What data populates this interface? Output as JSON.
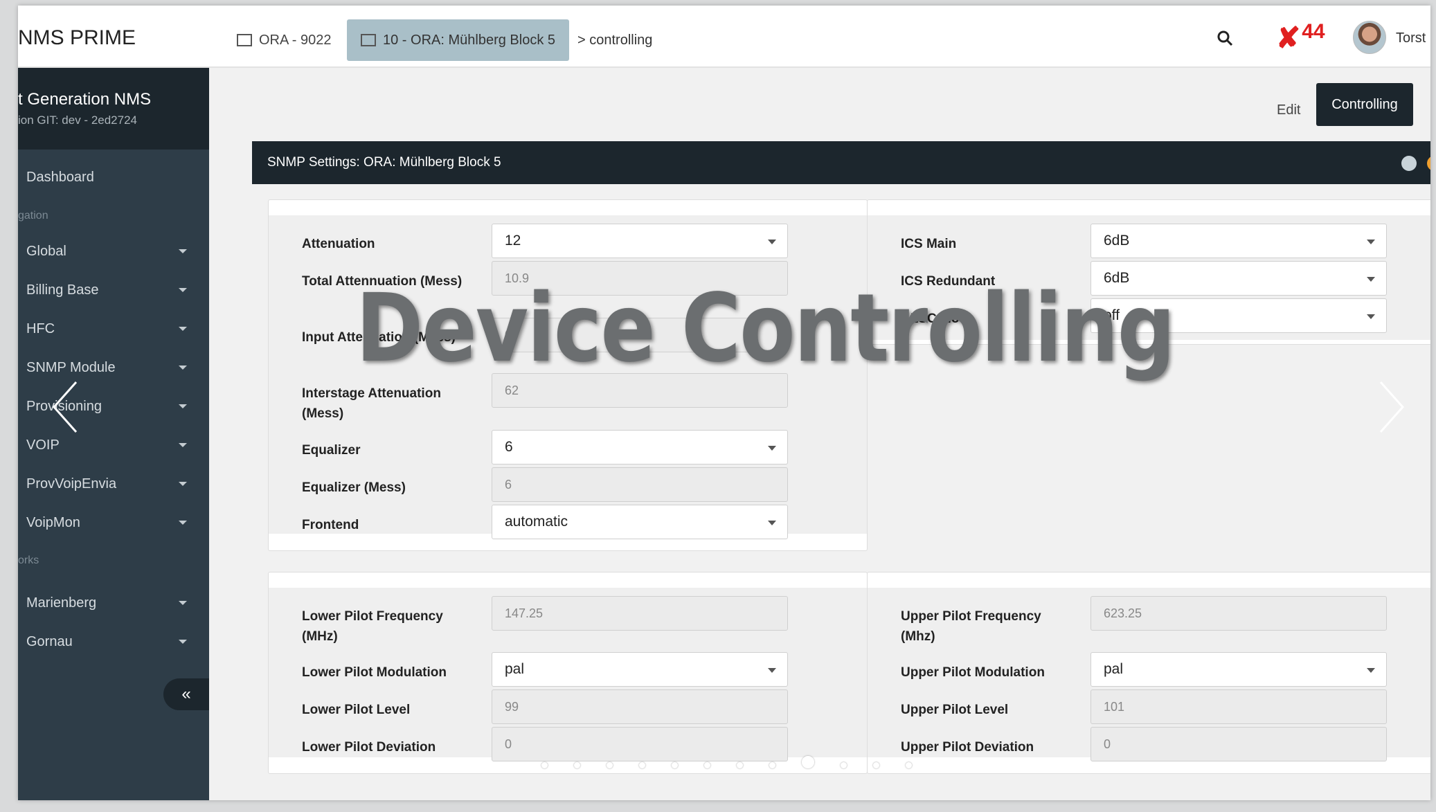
{
  "header": {
    "brand": "NMS PRIME",
    "breadcrumbs": [
      "ORA - 9022",
      "10 - ORA: Mühlberg Block 5"
    ],
    "breadcrumb_last": "> controlling",
    "alarm_count": "44",
    "username": "Torst"
  },
  "sidebar": {
    "title": "t Generation NMS",
    "subtitle": "ion GIT: dev - 2ed2724",
    "dashboard": "Dashboard",
    "section_1": "gation",
    "items": [
      "Global",
      "Billing Base",
      "HFC",
      "SNMP Module",
      "Provisioning",
      "VOIP",
      "ProvVoipEnvia",
      "VoipMon"
    ],
    "section_2": "orks",
    "networks": [
      "Marienberg",
      "Gornau"
    ],
    "collapse_label": "«"
  },
  "actions": {
    "edit": "Edit",
    "controlling": "Controlling"
  },
  "panel": {
    "title": "SNMP Settings: ORA: Mühlberg Block 5"
  },
  "form_left": {
    "attenuation": {
      "label": "Attenuation",
      "value": "12"
    },
    "total_attenuation": {
      "label": "Total Attennuation (Mess)",
      "value": "10.9"
    },
    "input_attenuation": {
      "label": "Input Attenuation (Mess)",
      "value": "0"
    },
    "interstage_attenuation": {
      "label": "Interstage Attenuation (Mess)",
      "value": "62"
    },
    "equalizer": {
      "label": "Equalizer",
      "value": "6"
    },
    "equalizer_mess": {
      "label": "Equalizer (Mess)",
      "value": "6"
    },
    "frontend": {
      "label": "Frontend",
      "value": "automatic"
    }
  },
  "form_right": {
    "ics_main": {
      "label": "ICS Main",
      "value": "6dB"
    },
    "ics_redundant": {
      "label": "ICS Redundant",
      "value": "6dB"
    },
    "alsc_mode": {
      "label": "ALSC Mode",
      "value": "off"
    }
  },
  "pilot_left": {
    "frequency": {
      "label": "Lower Pilot Frequency (MHz)",
      "value": "147.25"
    },
    "modulation": {
      "label": "Lower Pilot Modulation",
      "value": "pal"
    },
    "level": {
      "label": "Lower Pilot Level",
      "value": "99"
    },
    "deviation": {
      "label": "Lower Pilot Deviation",
      "value": "0"
    }
  },
  "pilot_right": {
    "frequency": {
      "label": "Upper Pilot Frequency (Mhz)",
      "value": "623.25"
    },
    "modulation": {
      "label": "Upper Pilot Modulation",
      "value": "pal"
    },
    "level": {
      "label": "Upper Pilot Level",
      "value": "101"
    },
    "deviation": {
      "label": "Upper Pilot Deviation",
      "value": "0"
    }
  },
  "overlay": {
    "caption": "Device Controlling"
  },
  "colors": {
    "sidebar": "#2e3d48",
    "sidebar_dark": "#1c262d",
    "alarm": "#e02020",
    "active_crumb": "#a9bfc8"
  }
}
